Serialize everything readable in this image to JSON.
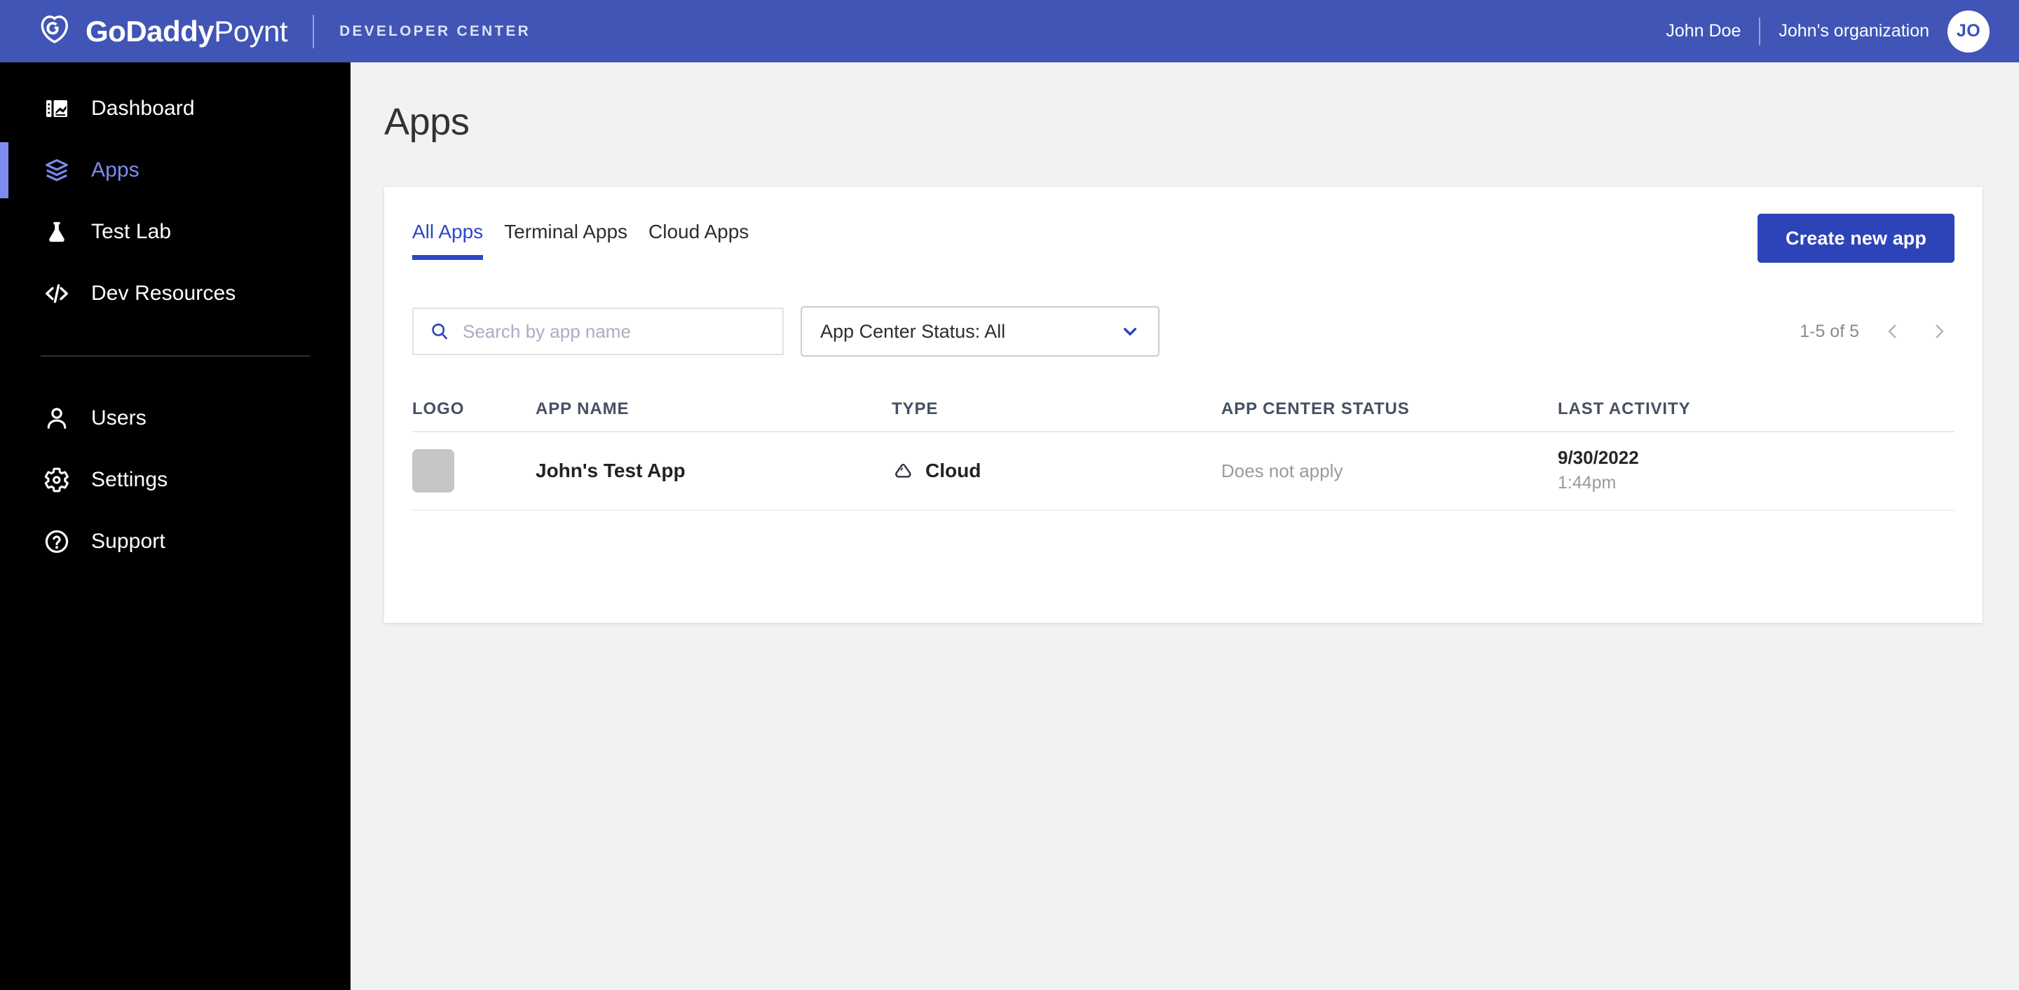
{
  "header": {
    "brand_bold": "GoDaddy",
    "brand_light": "Poynt",
    "brand_subtitle": "DEVELOPER CENTER",
    "user_name": "John Doe",
    "org_name": "John's organization",
    "avatar_initials": "JO",
    "background_color": "#4055b5"
  },
  "sidebar": {
    "background_color": "#000000",
    "active_color": "#7b8cf0",
    "items": [
      {
        "label": "Dashboard",
        "icon": "dashboard-icon",
        "active": false
      },
      {
        "label": "Apps",
        "icon": "layers-icon",
        "active": true
      },
      {
        "label": "Test Lab",
        "icon": "flask-icon",
        "active": false
      },
      {
        "label": "Dev Resources",
        "icon": "code-icon",
        "active": false
      }
    ],
    "secondary_items": [
      {
        "label": "Users",
        "icon": "person-icon"
      },
      {
        "label": "Settings",
        "icon": "gear-icon"
      },
      {
        "label": "Support",
        "icon": "help-circle-icon"
      }
    ]
  },
  "main": {
    "page_title": "Apps",
    "tabs": [
      {
        "label": "All Apps",
        "active": true
      },
      {
        "label": "Terminal Apps",
        "active": false
      },
      {
        "label": "Cloud Apps",
        "active": false
      }
    ],
    "create_button_label": "Create new app",
    "accent_color": "#2c44b8",
    "search": {
      "placeholder": "Search by app name",
      "value": "",
      "icon": "search-icon"
    },
    "status_filter": {
      "selected": "App Center Status: All",
      "icon": "chevron-down-icon"
    },
    "pagination": {
      "range": "1-5 of 5",
      "prev_icon": "chevron-left-icon",
      "next_icon": "chevron-right-icon"
    },
    "table": {
      "columns": [
        "LOGO",
        "APP NAME",
        "TYPE",
        "APP CENTER STATUS",
        "LAST ACTIVITY"
      ],
      "rows": [
        {
          "logo": "",
          "app_name": "John's Test App",
          "type": "Cloud",
          "type_icon": "cloud-icon",
          "app_center_status": "Does not apply",
          "last_activity_date": "9/30/2022",
          "last_activity_time": "1:44pm"
        }
      ]
    }
  }
}
